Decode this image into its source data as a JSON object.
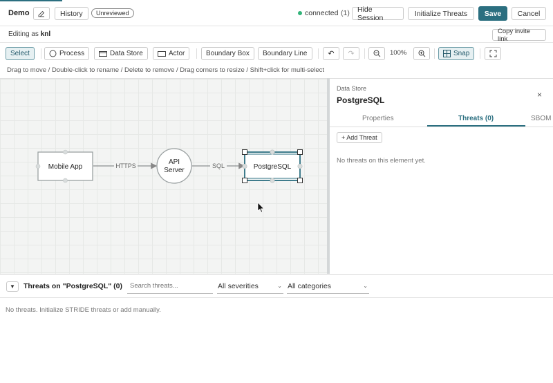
{
  "header": {
    "title": "Demo",
    "history_label": "History",
    "review_badge": "Unreviewed",
    "connection_status": "connected",
    "connection_count": "(1)",
    "hide_session_label": "Hide Session",
    "init_threats_label": "Initialize Threats",
    "save_label": "Save",
    "cancel_label": "Cancel"
  },
  "session": {
    "editing_as_prefix": "Editing as",
    "username": "knl",
    "copy_invite_label": "Copy invite link"
  },
  "toolbar": {
    "select_label": "Select",
    "process_label": "Process",
    "data_store_label": "Data Store",
    "actor_label": "Actor",
    "boundary_box_label": "Boundary Box",
    "boundary_line_label": "Boundary Line",
    "zoom_level": "100%",
    "snap_label": "Snap"
  },
  "hint": "Drag to move / Double-click to rename / Delete to remove / Drag corners to resize / Shift+click for multi-select",
  "diagram": {
    "nodes": [
      {
        "id": "mobile-app",
        "label": "Mobile App",
        "kind": "actor"
      },
      {
        "id": "api-server",
        "label_line1": "API",
        "label_line2": "Server",
        "kind": "process"
      },
      {
        "id": "postgresql",
        "label": "PostgreSQL",
        "kind": "data-store",
        "selected": true
      }
    ],
    "edges": [
      {
        "from": "mobile-app",
        "to": "api-server",
        "label": "HTTPS"
      },
      {
        "from": "api-server",
        "to": "postgresql",
        "label": "SQL"
      }
    ]
  },
  "panel": {
    "element_type": "Data Store",
    "element_name": "PostgreSQL",
    "tabs": [
      "Properties",
      "Threats (0)",
      "SBOM"
    ],
    "active_tab": "Threats (0)",
    "add_threat_label": "+ Add Threat",
    "empty_text": "No threats on this element yet."
  },
  "threats_section": {
    "title": "Threats on \"PostgreSQL\" (0)",
    "search_placeholder": "Search threats...",
    "severity_filter": "All severities",
    "category_filter": "All categories",
    "empty_text": "No threats. Initialize STRIDE threats or add manually."
  },
  "colors": {
    "accent": "#2b6f80",
    "connected": "#33b47a",
    "canvas_bg": "#f3f4f3"
  }
}
